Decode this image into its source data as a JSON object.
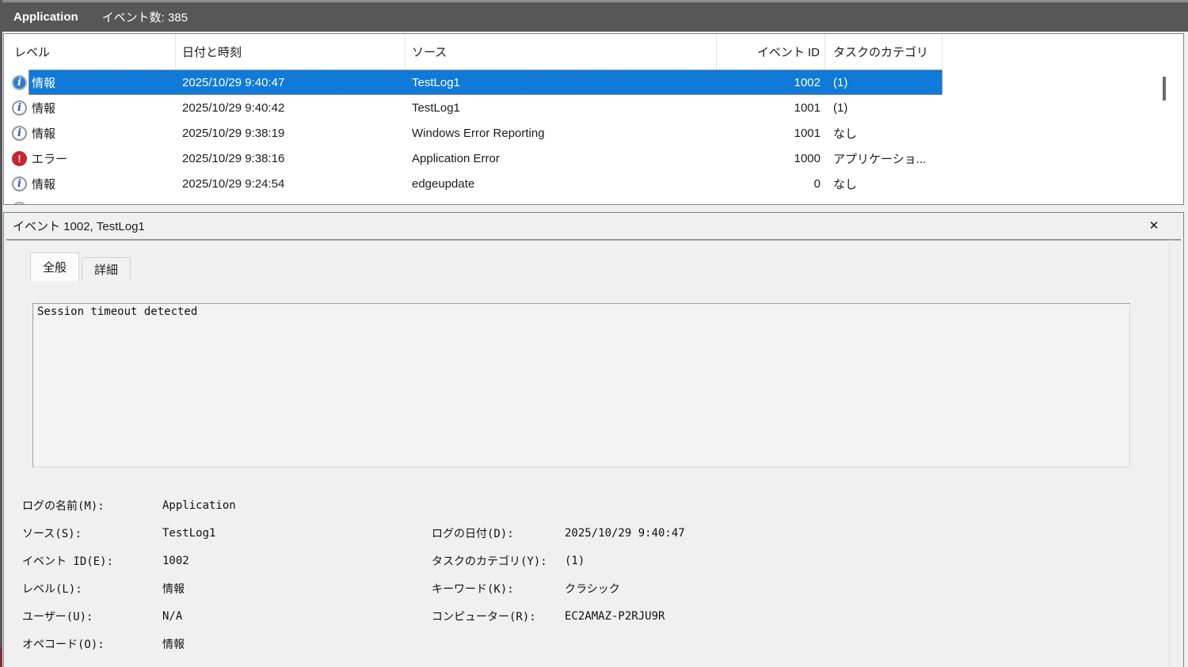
{
  "topbar": {
    "log_name": "Application",
    "event_count": "イベント数: 385"
  },
  "list": {
    "columns": [
      {
        "label": "レベル"
      },
      {
        "label": "日付と時刻"
      },
      {
        "label": "ソース"
      },
      {
        "label": "イベント ID"
      },
      {
        "label": "タスクのカテゴリ"
      }
    ],
    "rows": [
      {
        "level": "情報",
        "datetime": "2025/10/29 9:40:47",
        "source": "TestLog1",
        "event_id": "1002",
        "category": "(1)",
        "icon": "info",
        "selected": true
      },
      {
        "level": "情報",
        "datetime": "2025/10/29 9:40:42",
        "source": "TestLog1",
        "event_id": "1001",
        "category": "(1)",
        "icon": "info",
        "selected": false
      },
      {
        "level": "情報",
        "datetime": "2025/10/29 9:38:19",
        "source": "Windows Error Reporting",
        "event_id": "1001",
        "category": "なし",
        "icon": "info",
        "selected": false
      },
      {
        "level": "エラー",
        "datetime": "2025/10/29 9:38:16",
        "source": "Application Error",
        "event_id": "1000",
        "category": "アプリケーショ...",
        "icon": "error",
        "selected": false
      },
      {
        "level": "情報",
        "datetime": "2025/10/29 9:24:54",
        "source": "edgeupdate",
        "event_id": "0",
        "category": "なし",
        "icon": "info",
        "selected": false
      }
    ]
  },
  "detail": {
    "title": "イベント 1002, TestLog1",
    "tabs": [
      {
        "label": "全般",
        "active": true
      },
      {
        "label": "詳細",
        "active": false
      }
    ],
    "message": "Session timeout detected",
    "fields": [
      {
        "label1": "ログの名前(M):",
        "value1": "Application",
        "label2": "",
        "value2": ""
      },
      {
        "label1": "ソース(S):",
        "value1": "TestLog1",
        "label2": "ログの日付(D):",
        "value2": "2025/10/29 9:40:47"
      },
      {
        "label1": "イベント ID(E):",
        "value1": "1002",
        "label2": "タスクのカテゴリ(Y):",
        "value2": "(1)"
      },
      {
        "label1": "レベル(L):",
        "value1": "情報",
        "label2": "キーワード(K):",
        "value2": "クラシック"
      },
      {
        "label1": "ユーザー(U):",
        "value1": "N/A",
        "label2": "コンピューター(R):",
        "value2": "EC2AMAZ-P2RJU9R"
      },
      {
        "label1": "オペコード(O):",
        "value1": "情報",
        "label2": "",
        "value2": ""
      }
    ]
  },
  "icons": {
    "info_glyph": "i",
    "error_glyph": "!",
    "close_glyph": "✕"
  },
  "colors": {
    "selection_blue": "#0f7ad8",
    "focus_dotted_orange": "#f09a50",
    "error_red": "#c9232f",
    "info_blue": "#2b50c8",
    "titlebar_gray": "#575757",
    "pane_background": "#f0f0f0"
  }
}
